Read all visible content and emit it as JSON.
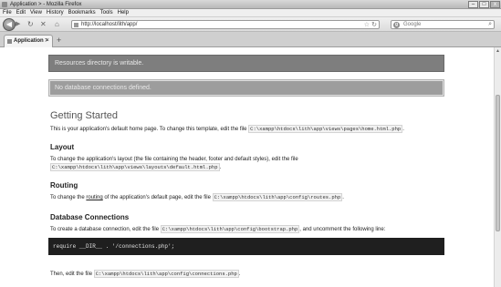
{
  "window": {
    "title": "Application > - Mozilla Firefox",
    "min_glyph": "–",
    "max_glyph": "□",
    "close_glyph": "x"
  },
  "menu": [
    "File",
    "Edit",
    "View",
    "History",
    "Bookmarks",
    "Tools",
    "Help"
  ],
  "nav": {
    "back_glyph": "◀",
    "forward_glyph": "▶",
    "reload_glyph": "↻",
    "stop_glyph": "✕",
    "home_glyph": "⌂",
    "url": "http://localhost/lith/app/",
    "star_glyph": "☆",
    "search_placeholder": "Google",
    "search_glyph": "⌕"
  },
  "tabs": [
    {
      "label": "Application >",
      "close_glyph": "×"
    }
  ],
  "new_tab_glyph": "+",
  "notices": {
    "resources": "Resources directory is writable.",
    "database": "No database connections defined."
  },
  "getting_started": {
    "heading": "Getting Started",
    "text_before": "This is your application's default home page. To change this template, edit the file ",
    "file": "C:\\xampp\\htdocs\\lith\\app\\views\\pages\\home.html.php",
    "text_after": "."
  },
  "layout": {
    "heading": "Layout",
    "line1": "To change the application's layout (the file containing the header, footer and default styles), edit the file",
    "file": "C:\\xampp\\htdocs\\lith\\app\\views\\layouts\\default.html.php",
    "text_after": "."
  },
  "routing": {
    "heading": "Routing",
    "text_before": "To change the ",
    "link": "routing",
    "text_middle": " of the application's default page, edit the file ",
    "file": "C:\\xampp\\htdocs\\lith\\app\\config\\routes.php",
    "text_after": "."
  },
  "database": {
    "heading": "Database Connections",
    "text_before": "To create a database connection, edit the file ",
    "file": "C:\\xampp\\htdocs\\lith\\app\\config\\bootstrap.php",
    "text_after": ", and uncomment the following line:",
    "code": "require __DIR__ . '/connections.php';",
    "then_before": "Then, edit the file ",
    "then_file": "C:\\xampp\\htdocs\\lith\\app\\config\\connections.php",
    "then_after": "."
  }
}
